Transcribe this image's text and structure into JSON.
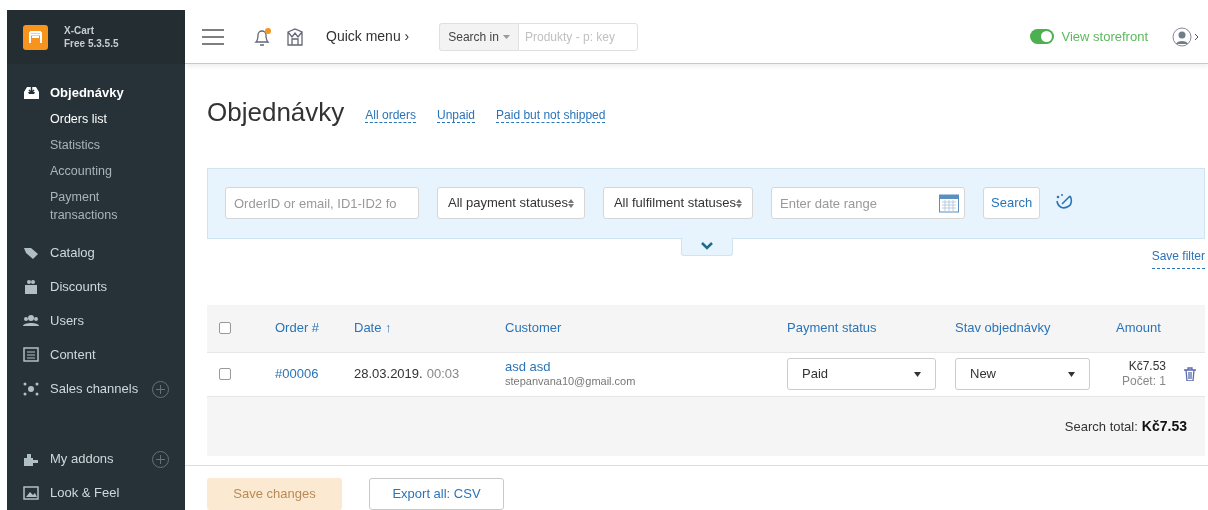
{
  "brand": {
    "name": "X-Cart",
    "version": "Free 5.3.5.5"
  },
  "header": {
    "notification_unread": true,
    "quick_menu": "Quick menu ›",
    "search_scope": "Search in",
    "search_placeholder": "Produkty - p: key",
    "storefront": {
      "label": "View storefront",
      "on": true
    }
  },
  "sidebar": {
    "items": [
      {
        "label": "Objednávky",
        "kind": "section",
        "expanded": true,
        "children": [
          {
            "label": "Orders list",
            "selected": true
          },
          {
            "label": "Statistics",
            "selected": false
          },
          {
            "label": "Accounting",
            "selected": false
          },
          {
            "label": "Payment transactions",
            "selected": false
          }
        ]
      },
      {
        "label": "Catalog",
        "kind": "item"
      },
      {
        "label": "Discounts",
        "kind": "item"
      },
      {
        "label": "Users",
        "kind": "item"
      },
      {
        "label": "Content",
        "kind": "item"
      },
      {
        "label": "Sales channels",
        "kind": "addable"
      },
      {
        "label": "My addons",
        "kind": "addable"
      },
      {
        "label": "Look & Feel",
        "kind": "item"
      }
    ]
  },
  "page": {
    "title": "Objednávky",
    "quick_filters": [
      "All orders",
      "Unpaid",
      "Paid but not shipped"
    ]
  },
  "filter": {
    "query_placeholder": "OrderID or email, ID1-ID2 fo",
    "payment": "All payment statuses",
    "fulfilment": "All fulfilment statuses",
    "date_placeholder": "Enter date range",
    "search": "Search",
    "save_filter": "Save filter"
  },
  "table": {
    "columns": [
      "Order #",
      "Date ↑",
      "Customer",
      "Payment status",
      "Stav objednávky",
      "Amount"
    ],
    "all_checked": false,
    "rows": [
      {
        "checked": false,
        "order": "#00006",
        "date": "28.03.2019.",
        "time": "00:03",
        "name": "asd asd",
        "email": "stepanvana10@gmail.com",
        "payment": "Paid",
        "status": "New",
        "amount": "Kč7.53",
        "count": "Počet: 1"
      }
    ],
    "total_label": "Search total:",
    "total": "Kč7.53"
  },
  "footer": {
    "save": {
      "label": "Save changes",
      "disabled": true
    },
    "export": "Export all: CSV"
  }
}
